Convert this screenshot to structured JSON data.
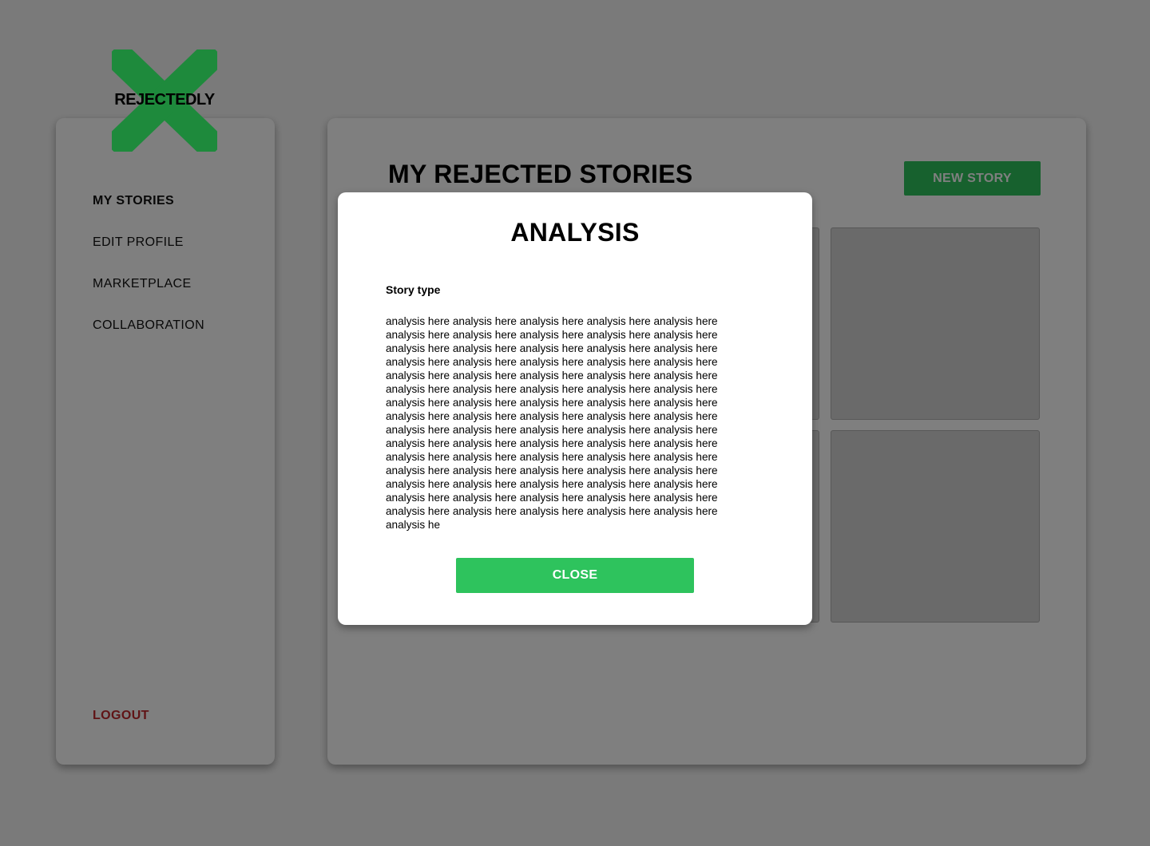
{
  "brand": {
    "name": "REJECTEDLY",
    "logo_color": "#1e8a3c"
  },
  "sidebar": {
    "items": [
      {
        "label": "MY STORIES",
        "active": true
      },
      {
        "label": "EDIT PROFILE",
        "active": false
      },
      {
        "label": "MARKETPLACE",
        "active": false
      },
      {
        "label": "COLLABORATION",
        "active": false
      }
    ],
    "logout_label": "LOGOUT"
  },
  "main": {
    "title": "MY REJECTED STORIES",
    "new_story_label": "NEW STORY"
  },
  "modal": {
    "title": "ANALYSIS",
    "label": "Story type",
    "body": "analysis here analysis here analysis here analysis here analysis here analysis here analysis here analysis here analysis here analysis here analysis here analysis here analysis here analysis here analysis here analysis here analysis here analysis here analysis here analysis here analysis here analysis here analysis here analysis here analysis here analysis here analysis here analysis here analysis here analysis here analysis here analysis here analysis here analysis here analysis here analysis here analysis here analysis here analysis here analysis here analysis here analysis here analysis here analysis here analysis here analysis here analysis here analysis here analysis here analysis here analysis here analysis here analysis here analysis here analysis here analysis here analysis here analysis here analysis here analysis here analysis here analysis here analysis here analysis here analysis here analysis here analysis here analysis here analysis here analysis here analysis here analysis here analysis here analysis here analysis here analysis he",
    "close_label": "CLOSE"
  },
  "colors": {
    "accent": "#2ec35d",
    "logout": "#c0282d",
    "overlay": "rgba(0,0,0,0.5)"
  }
}
